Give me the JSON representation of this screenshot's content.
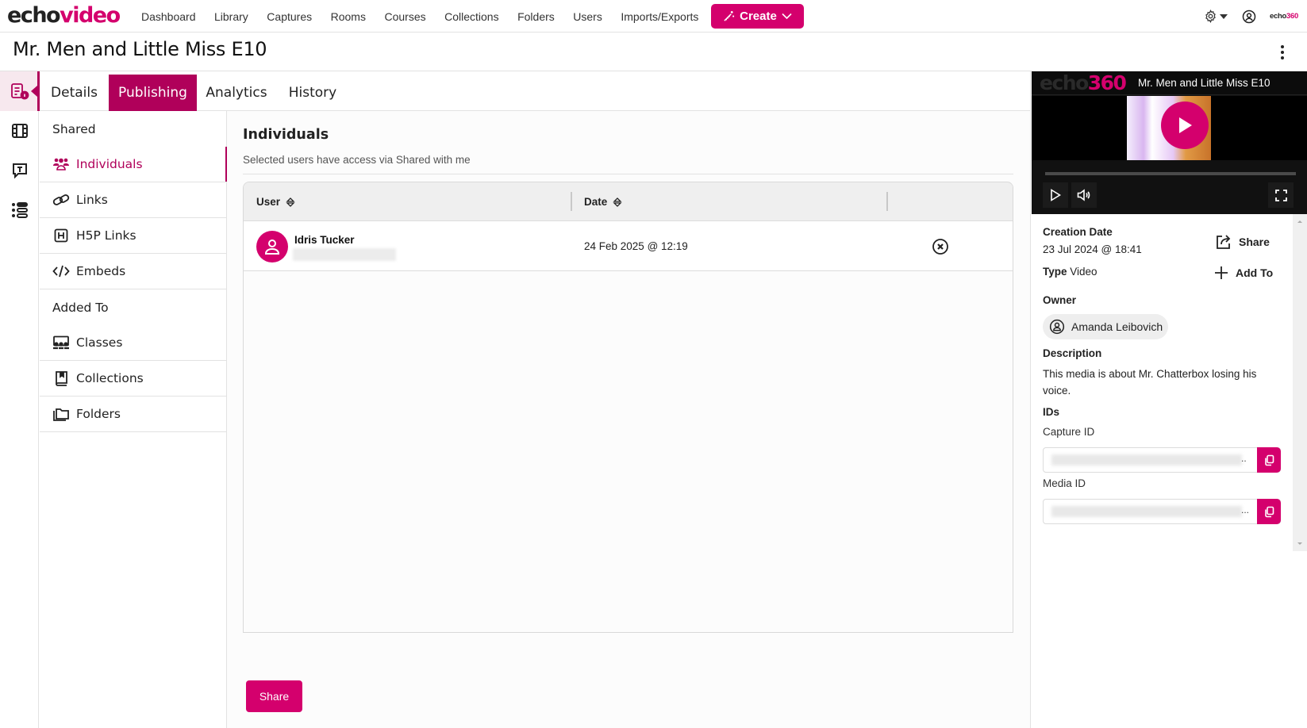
{
  "app": {
    "logo_left": "echo",
    "logo_right": "video",
    "brand_color": "#d4006d",
    "accent_dark": "#b0005a"
  },
  "nav": {
    "links": [
      "Dashboard",
      "Library",
      "Captures",
      "Rooms",
      "Courses",
      "Collections",
      "Folders",
      "Users",
      "Imports/Exports"
    ],
    "create_label": "Create",
    "settings_icon": "gear-icon",
    "user_icon": "user-circle-icon",
    "partner_logo_left": "echo",
    "partner_logo_right": "360"
  },
  "page": {
    "title": "Mr. Men and Little Miss E10"
  },
  "tabs": [
    {
      "label": "Details",
      "active": false
    },
    {
      "label": "Publishing",
      "active": true
    },
    {
      "label": "Analytics",
      "active": false
    },
    {
      "label": "History",
      "active": false
    }
  ],
  "rail": [
    "details-icon",
    "media-icon",
    "captions-icon",
    "outline-icon"
  ],
  "subnav": {
    "shared_heading": "Shared",
    "shared_items": [
      {
        "label": "Individuals",
        "icon": "users-icon",
        "active": true
      },
      {
        "label": "Links",
        "icon": "link-icon",
        "active": false
      },
      {
        "label": "H5P Links",
        "icon": "h5p-icon",
        "active": false
      },
      {
        "label": "Embeds",
        "icon": "code-icon",
        "active": false
      }
    ],
    "added_heading": "Added To",
    "added_items": [
      {
        "label": "Classes",
        "icon": "classes-icon"
      },
      {
        "label": "Collections",
        "icon": "collection-icon"
      },
      {
        "label": "Folders",
        "icon": "folders-icon"
      }
    ]
  },
  "main": {
    "heading": "Individuals",
    "subtitle": "Selected users have access via Shared with me",
    "table": {
      "columns": [
        "User",
        "Date"
      ],
      "rows": [
        {
          "user": "Idris Tucker",
          "email_redacted": true,
          "date": "24 Feb 2025 @ 12:19"
        }
      ]
    },
    "share_button": "Share"
  },
  "player": {
    "logo_left": "echo",
    "logo_right": "360",
    "title": "Mr. Men and Little Miss E10"
  },
  "details": {
    "creation_date_label": "Creation Date",
    "creation_date": "23 Jul 2024 @ 18:41",
    "type_label": "Type",
    "type_value": "Video",
    "share_action": "Share",
    "add_to_action": "Add To",
    "owner_label": "Owner",
    "owner": "Amanda Leibovich",
    "description_label": "Description",
    "description": "This media is about Mr. Chatterbox losing his voice.",
    "ids_label": "IDs",
    "capture_id_label": "Capture ID",
    "media_id_label": "Media ID",
    "capture_id_ellipsis": "..",
    "media_id_ellipsis": "..."
  }
}
